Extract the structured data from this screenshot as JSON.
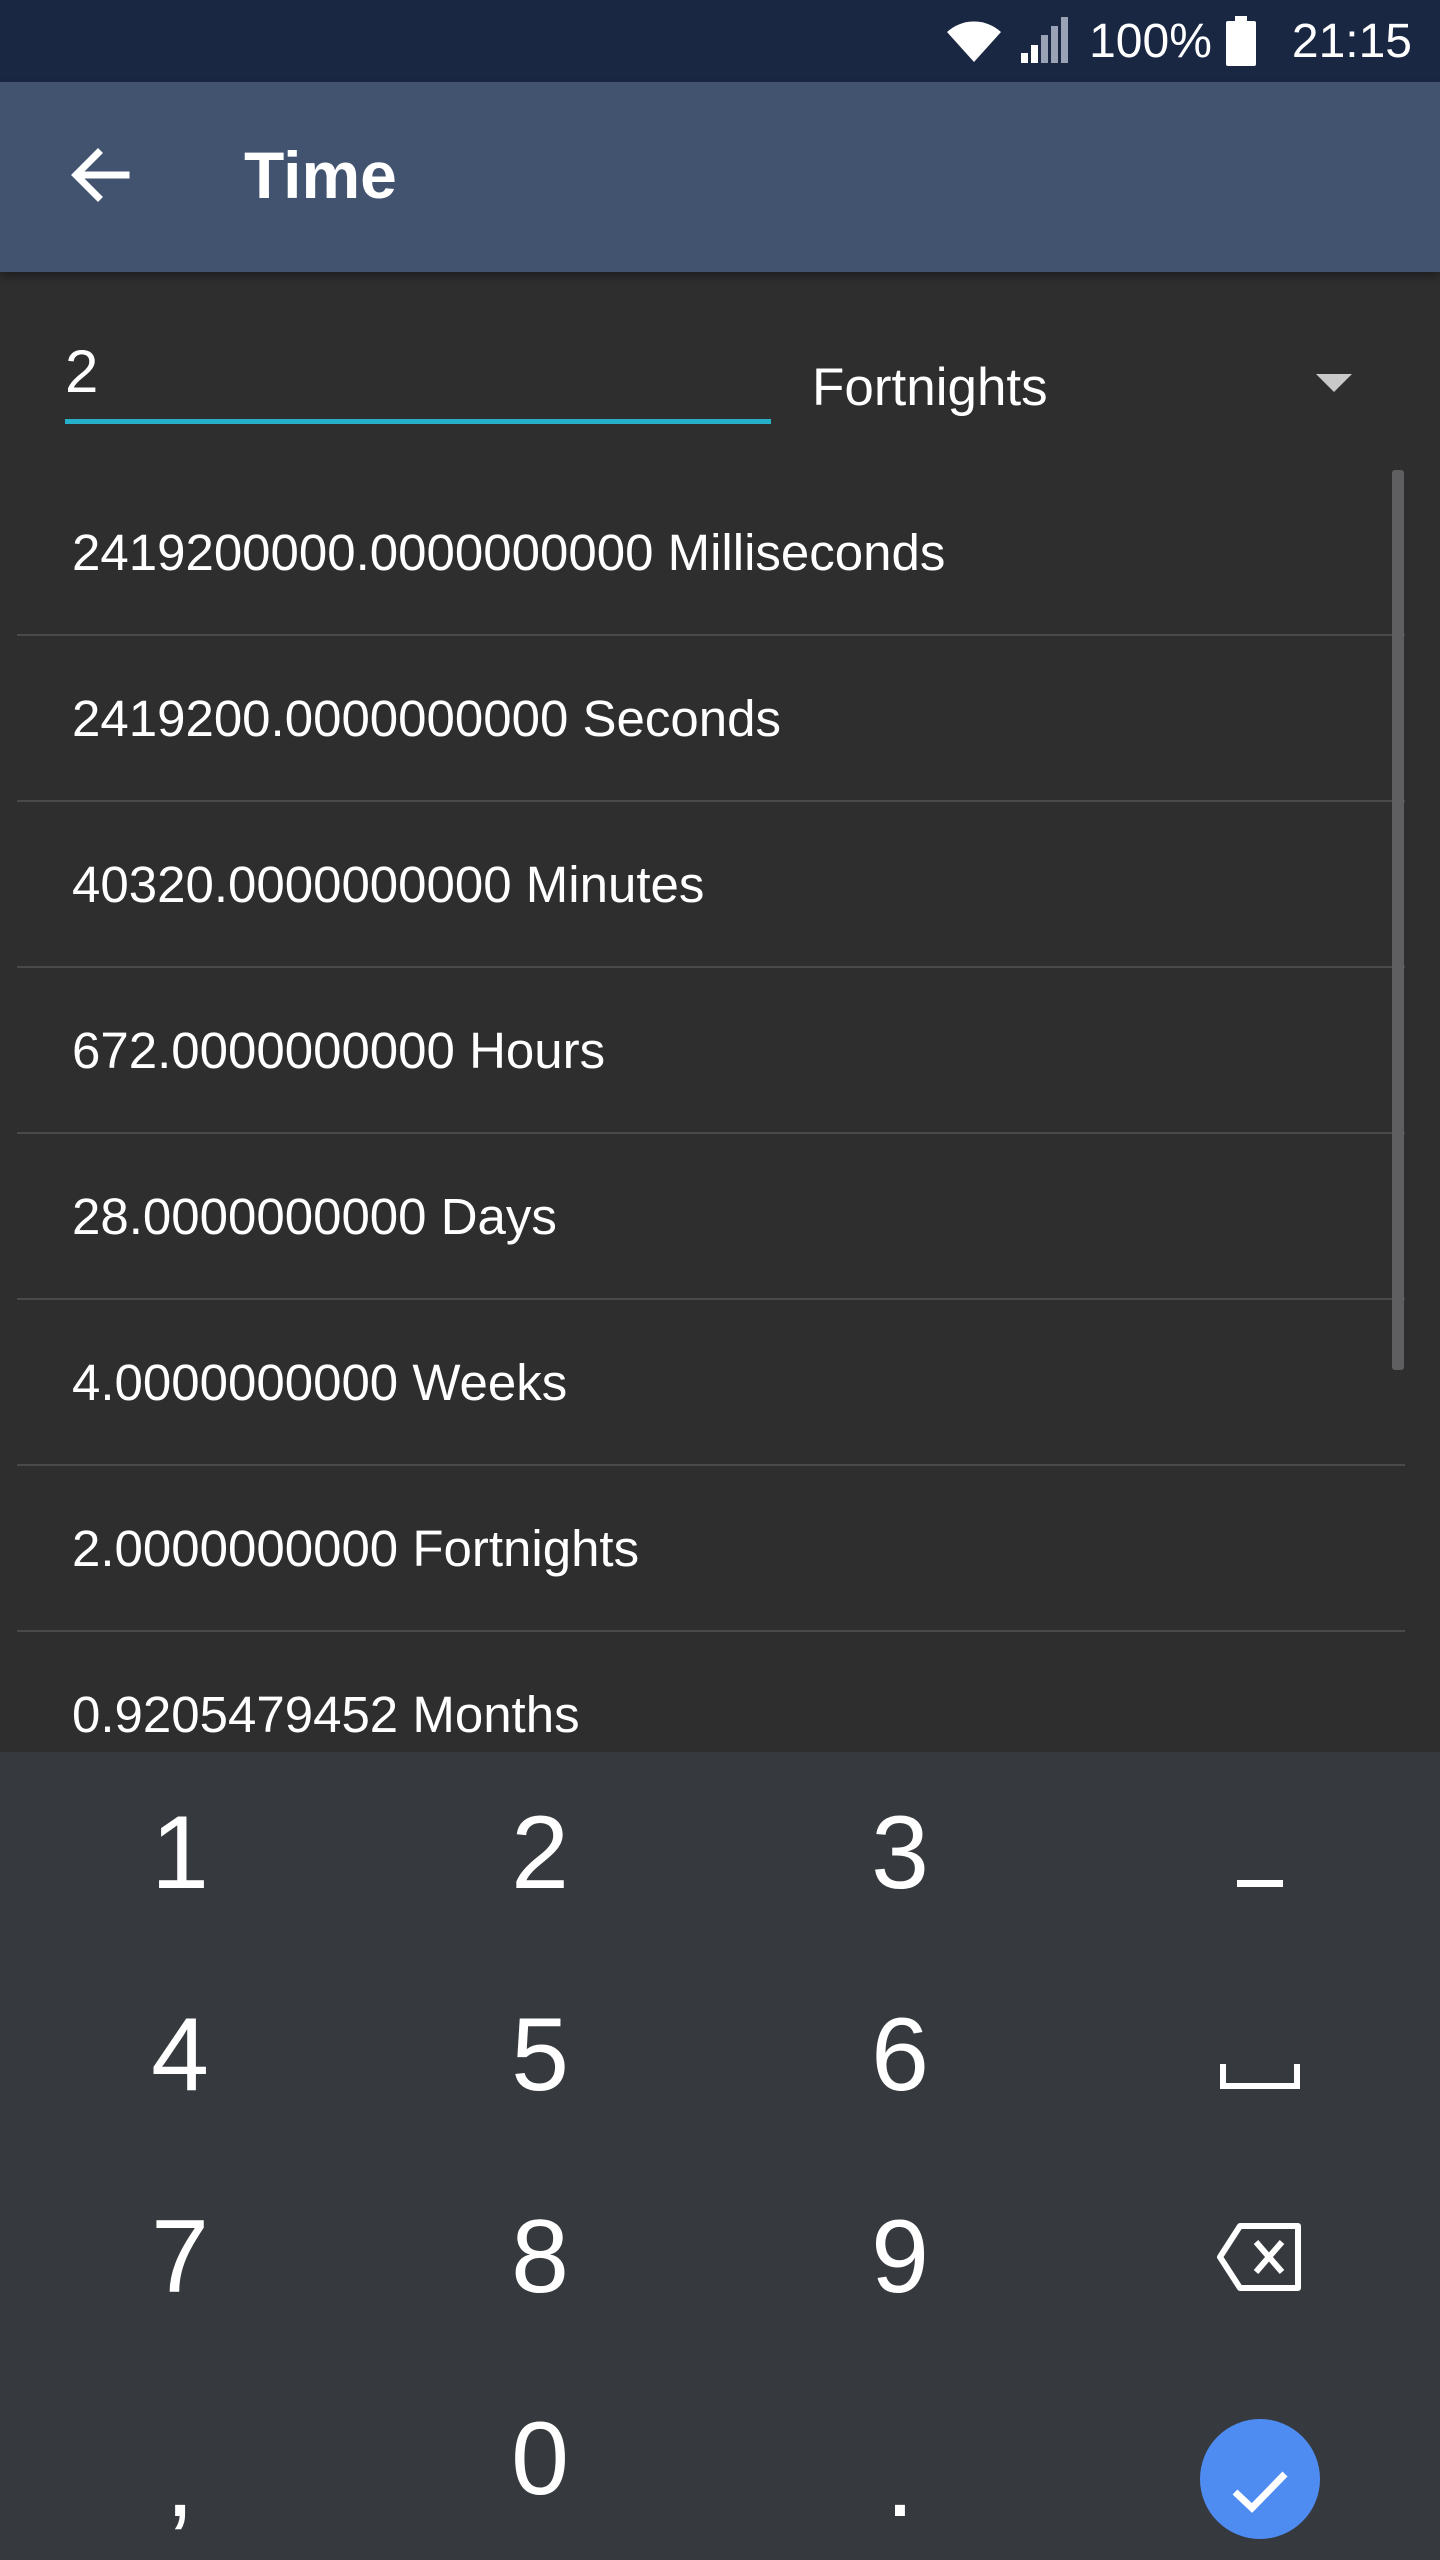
{
  "status_bar": {
    "battery": "100%",
    "time": "21:15"
  },
  "header": {
    "title": "Time",
    "back_icon": "arrow-left-icon"
  },
  "converter": {
    "input_value": "2",
    "unit": "Fortnights"
  },
  "results": [
    {
      "text": "2419200000.0000000000 Milliseconds"
    },
    {
      "text": "2419200.0000000000 Seconds"
    },
    {
      "text": "40320.0000000000 Minutes"
    },
    {
      "text": "672.0000000000 Hours"
    },
    {
      "text": "28.0000000000 Days"
    },
    {
      "text": "4.0000000000 Weeks"
    },
    {
      "text": "2.0000000000 Fortnights"
    },
    {
      "text": "0.9205479452 Months"
    }
  ],
  "keypad": {
    "keys": [
      "1",
      "2",
      "3",
      "−",
      "4",
      "5",
      "6",
      "␣",
      "7",
      "8",
      "9",
      "⌫",
      ",",
      "0",
      ".",
      "✓"
    ]
  },
  "colors": {
    "status_bar": "#1a2743",
    "app_bar": "#41536f",
    "background": "#2e2e2f",
    "input_underline": "#26b0c9",
    "keypad": "#363a3f",
    "done_button": "#4f8cf1"
  }
}
